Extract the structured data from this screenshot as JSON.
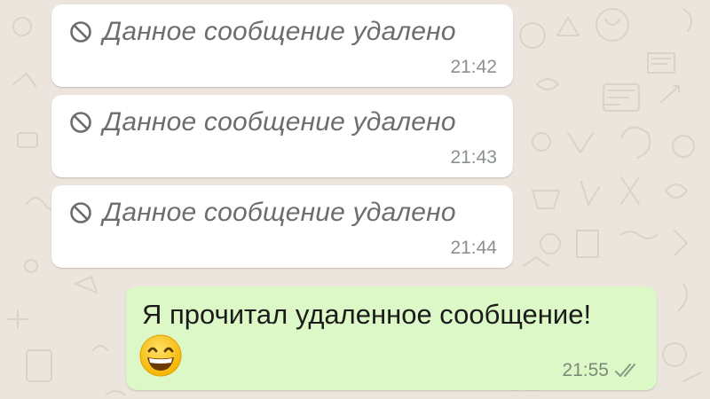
{
  "messages": [
    {
      "direction": "incoming",
      "deleted": true,
      "text": "Данное сообщение удалено",
      "time": "21:42",
      "icon": "ban-icon"
    },
    {
      "direction": "incoming",
      "deleted": true,
      "text": "Данное сообщение удалено",
      "time": "21:43",
      "icon": "ban-icon"
    },
    {
      "direction": "incoming",
      "deleted": true,
      "text": "Данное сообщение удалено",
      "time": "21:44",
      "icon": "ban-icon"
    },
    {
      "direction": "outgoing",
      "deleted": false,
      "text": "Я прочитал удаленное сообщение!",
      "emoji": "😄",
      "time": "21:55",
      "status_icon": "double-check-icon"
    }
  ],
  "colors": {
    "background": "#ece5dd",
    "incoming_bubble": "#ffffff",
    "outgoing_bubble": "#dcf8c6",
    "deleted_text": "#6d6d6d",
    "timestamp": "#8a8f91"
  }
}
